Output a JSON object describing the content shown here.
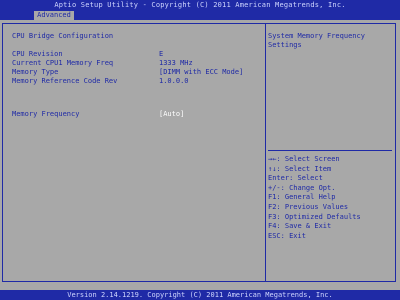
{
  "window": {
    "title": "Aptio Setup Utility - Copyright (C) 2011 American Megatrends, Inc."
  },
  "tabs": [
    {
      "label": "Advanced"
    }
  ],
  "main": {
    "section_title": "CPU Bridge Configuration",
    "info": [
      {
        "label": "CPU Revision",
        "value": "E"
      },
      {
        "label": "Current CPU1 Memory Freq",
        "value": "1333 MHz"
      },
      {
        "label": "Memory Type",
        "value": "[DIMM with ECC Mode]"
      },
      {
        "label": "Memory Reference Code Rev",
        "value": "1.0.0.0"
      }
    ],
    "setting": {
      "label": "Memory Frequency",
      "value": "[Auto]"
    }
  },
  "help": {
    "text": "System Memory Frequency Settings"
  },
  "keys": [
    "→←: Select Screen",
    "↑↓: Select Item",
    "Enter: Select",
    "+/-: Change Opt.",
    "F1: General Help",
    "F2: Previous Values",
    "F3: Optimized Defaults",
    "F4: Save & Exit",
    "ESC: Exit"
  ],
  "footer": {
    "text": "Version 2.14.1219. Copyright (C) 2011 American Megatrends, Inc."
  }
}
